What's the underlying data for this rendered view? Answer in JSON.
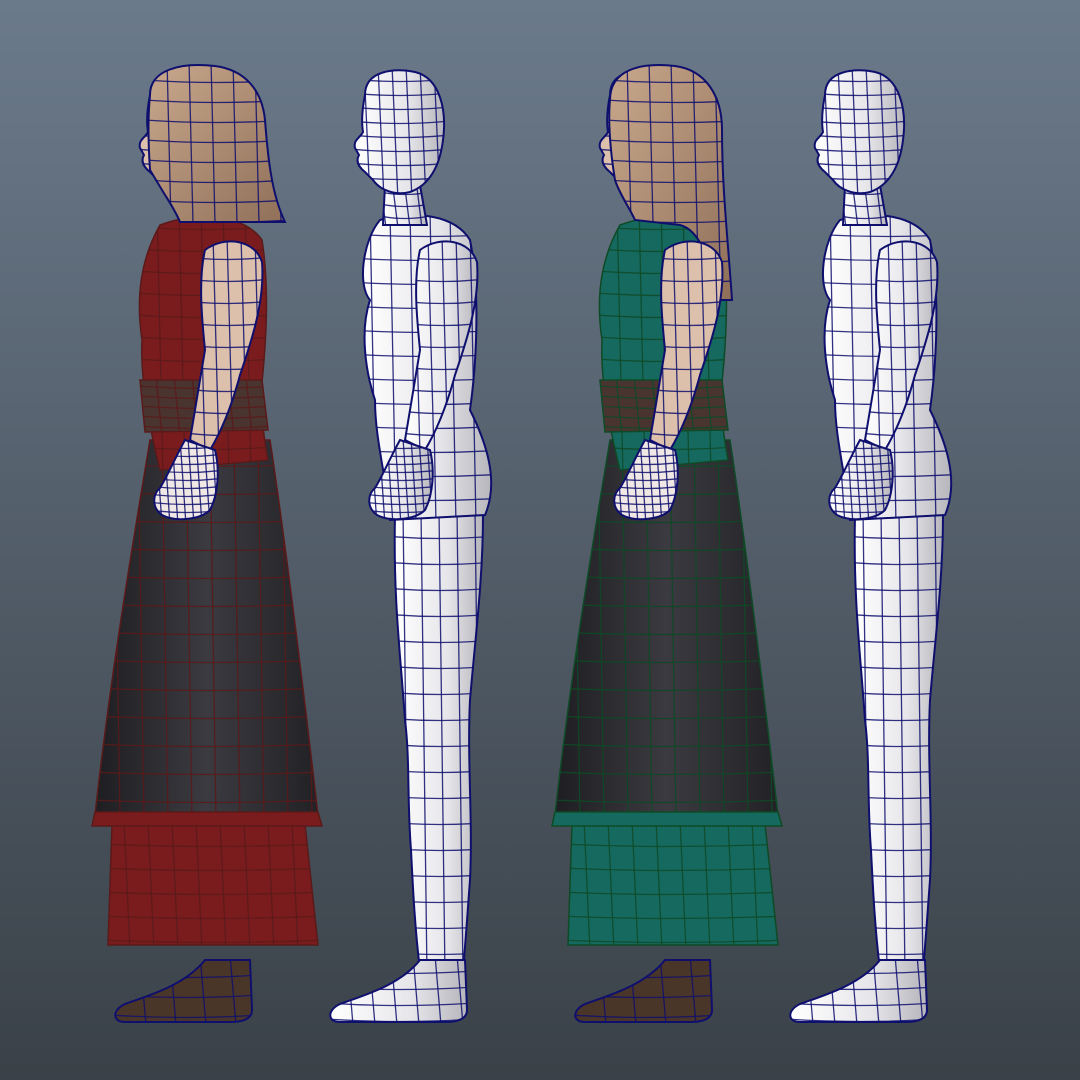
{
  "viewport": {
    "background_top": "#6b7a8b",
    "background_bottom": "#3a4148",
    "wireframe_color": "#0f0f6e"
  },
  "figures": [
    {
      "id": "figure-red-dress",
      "kind": "clothed",
      "hair": "bob",
      "garment_color": "#7a1c1e",
      "hair_color": "#b08d72",
      "skin_color": "#dcc0ac",
      "skirt_color": "#2a2a30",
      "wire_color": "#5a1a1a"
    },
    {
      "id": "figure-base-mesh-1",
      "kind": "base",
      "skin_color": "#e9e9ec"
    },
    {
      "id": "figure-teal-dress",
      "kind": "clothed",
      "hair": "long",
      "garment_color": "#16695f",
      "hair_color": "#b5967c",
      "skin_color": "#dcc0ac",
      "skirt_color": "#2a2f30",
      "wire_color": "#0e4a26"
    },
    {
      "id": "figure-base-mesh-2",
      "kind": "base",
      "skin_color": "#e9e9ec"
    }
  ]
}
